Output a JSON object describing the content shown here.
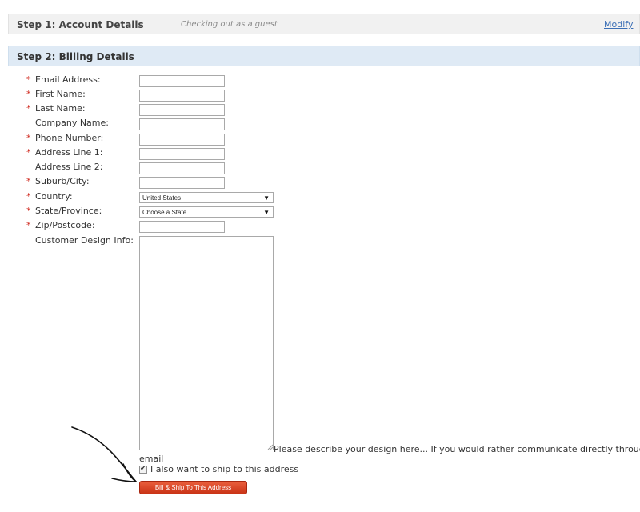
{
  "step1": {
    "title": "Step 1: Account Details",
    "note": "Checking out as a guest",
    "modify_link": "Modify"
  },
  "step2": {
    "title": "Step 2: Billing Details"
  },
  "fields": {
    "email": {
      "label": "Email Address:",
      "required": "*",
      "value": ""
    },
    "first_name": {
      "label": "First Name:",
      "required": "*",
      "value": ""
    },
    "last_name": {
      "label": "Last Name:",
      "required": "*",
      "value": ""
    },
    "company": {
      "label": "Company Name:",
      "value": ""
    },
    "phone": {
      "label": "Phone Number:",
      "required": "*",
      "value": ""
    },
    "address1": {
      "label": "Address Line 1:",
      "required": "*",
      "value": ""
    },
    "address2": {
      "label": "Address Line 2:",
      "value": ""
    },
    "city": {
      "label": "Suburb/City:",
      "required": "*",
      "value": ""
    },
    "country": {
      "label": "Country:",
      "required": "*",
      "selected": "United States"
    },
    "state": {
      "label": "State/Province:",
      "required": "*",
      "selected": "Choose a State"
    },
    "zip": {
      "label": "Zip/Postcode:",
      "required": "*",
      "value": ""
    },
    "design": {
      "label": "Customer Design Info:",
      "hint_line1": "Please describe your design here... If you would rather communicate directly through",
      "hint_line2": "email"
    }
  },
  "ship_checkbox": {
    "label": "I also want to ship to this address",
    "checked": true
  },
  "submit_button": {
    "label": "Bill & Ship To This Address"
  },
  "icons": {
    "select_arrow": "dropdown-arrow-icon",
    "checkmark": "checkmark-icon",
    "resize": "resize-grip-icon",
    "annotation": "hand-drawn-arrow-icon"
  },
  "colors": {
    "required": "#d0281e",
    "link": "#3b6fb6",
    "button": "#d9441f",
    "step2_header": "#dfeaf5"
  }
}
